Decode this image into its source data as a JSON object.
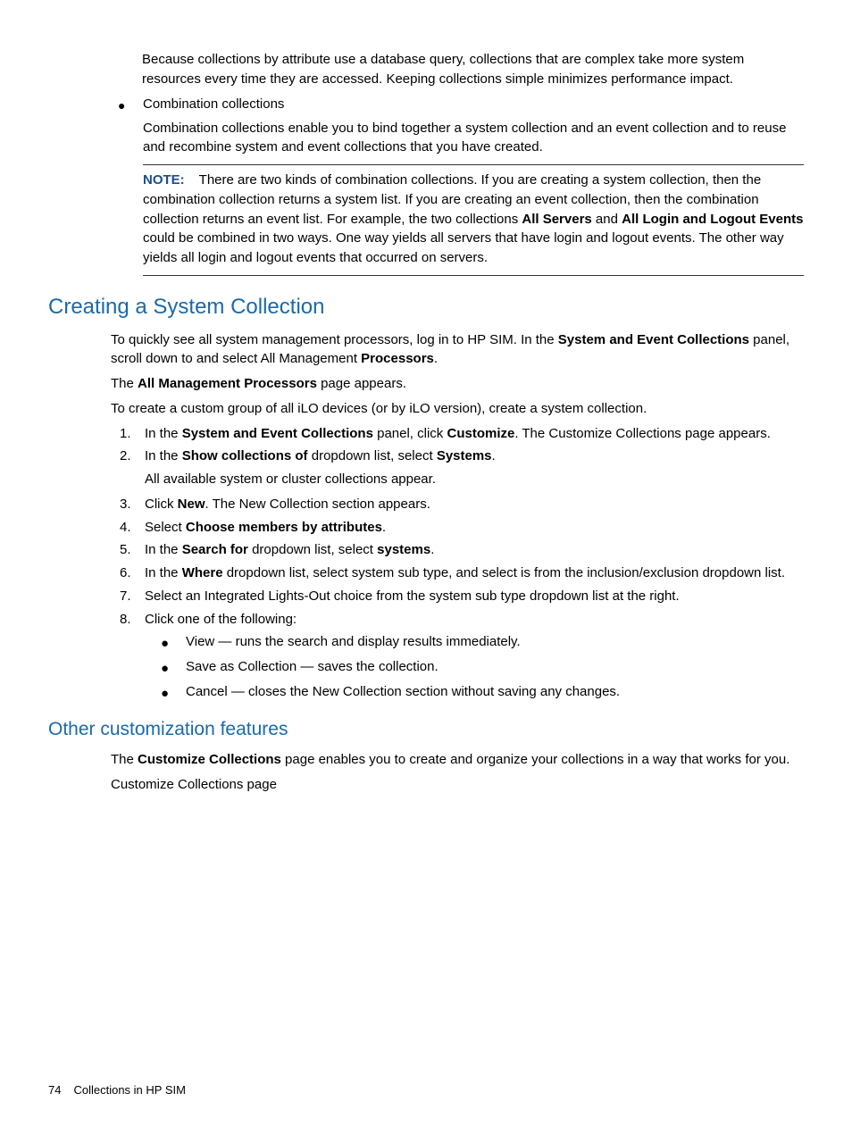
{
  "intro": {
    "p1": "Because collections by attribute use a database query, collections that are complex take more system resources every time they are accessed. Keeping collections simple minimizes performance impact.",
    "bullet": "Combination collections",
    "p2": "Combination collections enable you to bind together a system collection and an event collection and to reuse and recombine system and event collections that you have created."
  },
  "note": {
    "label": "NOTE:",
    "pre": "There are two kinds of combination collections. If you are creating a system collection, then the combination collection returns a system list. If you are creating an event collection, then the combination collection returns an event list. For example, the two collections ",
    "bold1": "All Servers",
    "mid1": " and ",
    "bold2": "All Login and Logout Events",
    "post": " could be combined in two ways. One way yields all servers that have login and logout events. The other way yields all login and logout events that occurred on servers."
  },
  "section1": {
    "title": "Creating a System Collection",
    "p1a": "To quickly see all system management processors, log in to HP SIM. In the ",
    "p1b": "System and Event Collections",
    "p1c": " panel, scroll down to and select All Management ",
    "p1d": "Processors",
    "p1e": ".",
    "p2a": "The ",
    "p2b": "All Management Processors",
    "p2c": " page appears.",
    "p3": "To create a custom group of all iLO devices (or by iLO version), create a system collection.",
    "steps": {
      "s1a": "In the ",
      "s1b": "System and Event Collections",
      "s1c": " panel, click ",
      "s1d": "Customize",
      "s1e": ". The Customize Collections page appears.",
      "s2a": "In the ",
      "s2b": "Show collections of",
      "s2c": " dropdown list, select ",
      "s2d": "Systems",
      "s2e": ".",
      "s2sub": "All available system or cluster collections appear.",
      "s3a": "Click ",
      "s3b": "New",
      "s3c": ". The New Collection section appears.",
      "s4a": "Select ",
      "s4b": "Choose members by attributes",
      "s4c": ".",
      "s5a": "In the ",
      "s5b": "Search for",
      "s5c": " dropdown list, select ",
      "s5d": "systems",
      "s5e": ".",
      "s6a": "In the ",
      "s6b": "Where",
      "s6c": " dropdown list, select system sub type, and select is from the inclusion/exclusion dropdown list.",
      "s7": "Select an Integrated Lights-Out choice from the system sub type dropdown list at the right.",
      "s8": "Click one of the following:",
      "sub1": "View — runs the search and display results immediately.",
      "sub2": "Save as Collection — saves the collection.",
      "sub3": "Cancel — closes the New Collection section without saving any changes."
    }
  },
  "section2": {
    "title": "Other customization features",
    "p1a": "The ",
    "p1b": "Customize Collections",
    "p1c": " page enables you to create and organize your collections in a way that works for you.",
    "p2": "Customize Collections page"
  },
  "footer": {
    "page": "74",
    "title": "Collections in HP SIM"
  }
}
